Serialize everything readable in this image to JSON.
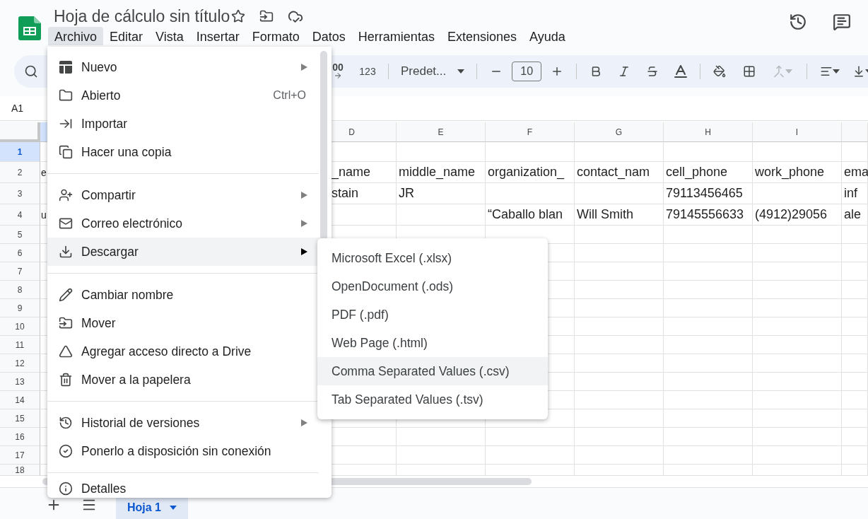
{
  "document": {
    "title": "Hoja de cálculo sin título"
  },
  "menubar": [
    {
      "label": "Archivo",
      "selected": true
    },
    {
      "label": "Editar",
      "selected": false
    },
    {
      "label": "Vista",
      "selected": false
    },
    {
      "label": "Insertar",
      "selected": false
    },
    {
      "label": "Formato",
      "selected": false
    },
    {
      "label": "Datos",
      "selected": false
    },
    {
      "label": "Herramientas",
      "selected": false
    },
    {
      "label": "Extensiones",
      "selected": false
    },
    {
      "label": "Ayuda",
      "selected": false
    }
  ],
  "toolbar": {
    "decimal_increase": "00",
    "number_format": "123",
    "font": "Predet...",
    "font_size": "10",
    "merge": {
      "disabled": true
    }
  },
  "name_box": "A1",
  "grid": {
    "columns": [
      {
        "selected": true
      },
      {
        "label": "D",
        "selected": false
      },
      {
        "label": "E",
        "selected": false
      },
      {
        "label": "F",
        "selected": false
      },
      {
        "label": "G",
        "selected": false
      },
      {
        "label": "H",
        "selected": false
      },
      {
        "label": "I",
        "selected": false
      },
      {
        "selected": false
      }
    ],
    "rows": [
      {
        "label": "1",
        "selected": true
      },
      {
        "label": "2",
        "selected": false,
        "cells": [
          "e",
          "_name",
          "middle_name",
          "organization_",
          "contact_nam",
          "cell_phone",
          "work_phone",
          "ema"
        ]
      },
      {
        "label": "3",
        "selected": false,
        "cells": [
          null,
          "stain",
          "JR",
          null,
          null,
          "79113456465",
          null,
          "inf"
        ]
      },
      {
        "label": "4",
        "selected": false,
        "cells": [
          "u",
          null,
          null,
          "“Caballo blan",
          "Will Smith",
          "79145556633",
          "(4912)29056",
          "ale"
        ]
      },
      {
        "label": "5",
        "selected": false
      },
      {
        "label": "6",
        "selected": false
      },
      {
        "label": "7",
        "selected": false
      },
      {
        "label": "8",
        "selected": false
      },
      {
        "label": "9",
        "selected": false
      },
      {
        "label": "10",
        "selected": false
      },
      {
        "label": "11",
        "selected": false
      },
      {
        "label": "12",
        "selected": false
      },
      {
        "label": "13",
        "selected": false
      },
      {
        "label": "14",
        "selected": false
      },
      {
        "label": "15",
        "selected": false
      },
      {
        "label": "16",
        "selected": false
      },
      {
        "label": "17",
        "selected": false
      },
      {
        "label": "18",
        "selected": false
      }
    ]
  },
  "file_menu": {
    "sections": [
      {
        "items": [
          {
            "label": "Nuevo",
            "submenu": true,
            "selected": false
          },
          {
            "label": "Abierto",
            "shortcut": "Ctrl+O",
            "submenu": false,
            "selected": false
          },
          {
            "label": "Importar",
            "submenu": false,
            "selected": false
          },
          {
            "label": "Hacer una copia",
            "submenu": false,
            "selected": false
          }
        ]
      },
      {
        "items": [
          {
            "label": "Compartir",
            "submenu": true,
            "selected": false
          },
          {
            "label": "Correo electrónico",
            "submenu": true,
            "selected": false
          },
          {
            "label": "Descargar",
            "submenu": true,
            "selected": true
          }
        ]
      },
      {
        "items": [
          {
            "label": "Cambiar nombre",
            "submenu": false,
            "selected": false
          },
          {
            "label": "Mover",
            "submenu": false,
            "selected": false
          },
          {
            "label": "Agregar acceso directo a Drive",
            "submenu": false,
            "selected": false
          },
          {
            "label": "Mover a la papelera",
            "submenu": false,
            "selected": false
          }
        ]
      },
      {
        "items": [
          {
            "label": "Historial de versiones",
            "submenu": true,
            "selected": false
          },
          {
            "label": "Ponerlo a disposición sin conexión",
            "submenu": false,
            "selected": false
          }
        ]
      },
      {
        "items": [
          {
            "label": "Detalles",
            "submenu": false,
            "selected": false
          }
        ]
      }
    ]
  },
  "download_submenu": {
    "items": [
      {
        "label": "Microsoft Excel (.xlsx)",
        "selected": false
      },
      {
        "label": "OpenDocument (.ods)",
        "selected": false
      },
      {
        "label": "PDF (.pdf)",
        "selected": false
      },
      {
        "label": "Web Page (.html)",
        "selected": false
      },
      {
        "label": "Comma Separated Values (.csv)",
        "selected": true
      },
      {
        "label": "Tab Separated Values (.tsv)",
        "selected": false
      }
    ]
  },
  "sheet_tabs": [
    {
      "label": "Hoja 1",
      "selected": true
    }
  ]
}
